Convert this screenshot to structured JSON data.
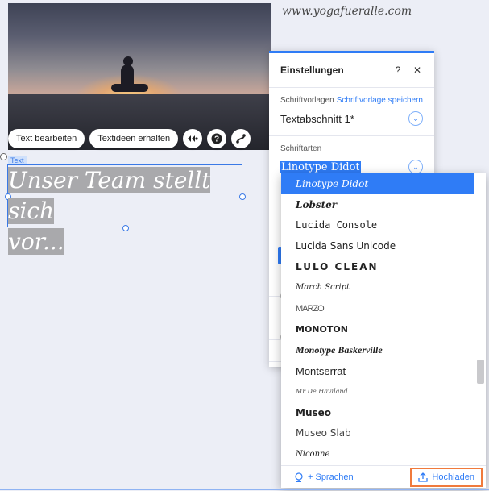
{
  "site": {
    "url": "www.yogafueralle.com"
  },
  "hero_toolbar": {
    "edit_text_label": "Text bearbeiten",
    "text_ideas_label": "Textideen erhalten",
    "icons": [
      "animation-icon",
      "help-icon",
      "link-icon"
    ]
  },
  "text_element": {
    "tag": "Text",
    "headline_line1": "Unser Team stellt sich",
    "headline_line2": "vor..."
  },
  "settings_panel": {
    "title": "Einstellungen",
    "help_label": "?",
    "close_label": "✕",
    "templates": {
      "label": "Schriftvorlagen",
      "save_link": "Schriftvorlage speichern",
      "value": "Textabschnitt 1*"
    },
    "fonts": {
      "label": "Schriftarten",
      "value": "Linotype Didot"
    }
  },
  "font_dropdown": {
    "items": [
      "Linotype Didot",
      "Lobster",
      "Lucida Console",
      "Lucida Sans Unicode",
      "LULO CLEAN",
      "March Script",
      "MARZO",
      "MONOTON",
      "Monotype Baskerville",
      "Montserrat",
      "Mr De Haviland",
      "Museo",
      "Museo Slab",
      "Niconne"
    ],
    "selected_index": 0,
    "languages_label": "+ Sprachen",
    "upload_label": "Hochladen"
  },
  "colors": {
    "accent": "#2f7cf6",
    "highlight_border": "#f07a3c"
  }
}
